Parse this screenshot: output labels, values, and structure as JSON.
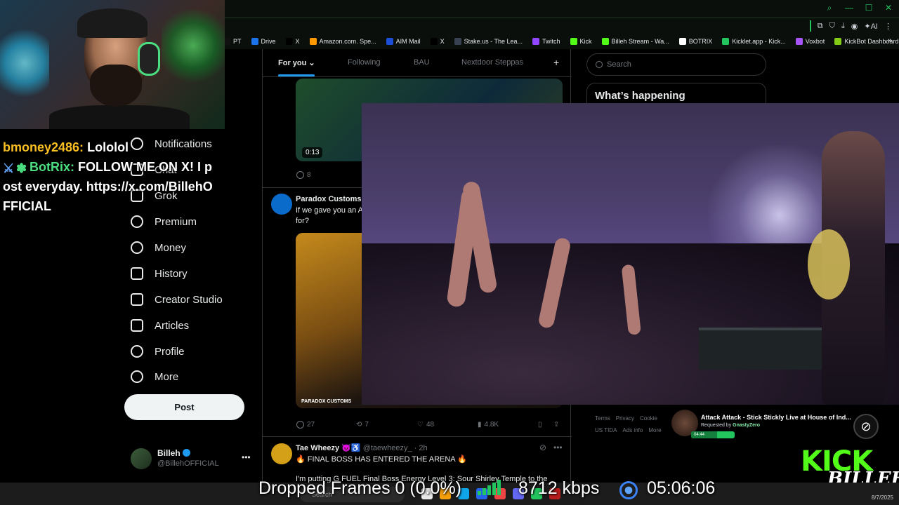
{
  "browser": {
    "bookmarks": [
      {
        "label": "PT",
        "color": "#111111"
      },
      {
        "label": "Drive",
        "color": "#1a73e8"
      },
      {
        "label": "X",
        "color": "#000000"
      },
      {
        "label": "Amazon.com. Spe...",
        "color": "#ff9900"
      },
      {
        "label": "AIM Mail",
        "color": "#1d4ed8"
      },
      {
        "label": "X",
        "color": "#000000"
      },
      {
        "label": "Stake.us - The Lea...",
        "color": "#374151"
      },
      {
        "label": "Twitch",
        "color": "#9146ff"
      },
      {
        "label": "Kick",
        "color": "#53fc18"
      },
      {
        "label": "Billeh Stream - Wa...",
        "color": "#53fc18"
      },
      {
        "label": "BOTRIX",
        "color": "#ffffff"
      },
      {
        "label": "Kicklet.app - Kick...",
        "color": "#22c55e"
      },
      {
        "label": "Voxbot",
        "color": "#a855f7"
      },
      {
        "label": "KickBot Dashboard",
        "color": "#84cc16"
      }
    ]
  },
  "nav": {
    "notifications": "Notifications",
    "chat": "Chat",
    "grok": "Grok",
    "premium": "Premium",
    "money": "Money",
    "history": "History",
    "creator_studio": "Creator Studio",
    "articles": "Articles",
    "profile": "Profile",
    "more": "More",
    "post_button": "Post"
  },
  "account": {
    "name": "Billeh",
    "handle": "@BillehOFFICIAL"
  },
  "feed": {
    "tabs": [
      "For you",
      "Following",
      "BAU",
      "Nextdoor Steppas"
    ],
    "post1": {
      "duration": "0:13",
      "replies": "8"
    },
    "post2": {
      "author": "Paradox Customs",
      "text_line1": "If we gave you an A",
      "text_line2": "for?",
      "media_caption": "PARADOX CUSTOMS",
      "replies": "27",
      "reposts": "7",
      "likes": "48",
      "views": "4.8K"
    },
    "post3": {
      "author": "Tae Wheezy",
      "handle": "@taewheezy_",
      "time": "· 2h",
      "text_line1": "🔥 FINAL BOSS HAS ENTERED THE ARENA 🔥",
      "text_line2": "I'm putting G FUEL Final Boss Energy Level 3: Sour Shirley Temple to the"
    }
  },
  "right": {
    "search_placeholder": "Search",
    "trends_title": "What’s happening",
    "footer": [
      "Terms",
      "Privacy",
      "Cookie",
      "US TIDA",
      "Ads info",
      "More"
    ]
  },
  "stream": {
    "chat": [
      {
        "user": "bmoney2486:",
        "message": "Lololol"
      },
      {
        "user": "BotRix:",
        "message": "FOLLOW ME ON X! I post everyday. https://x.com/BillehOFFICIAL"
      }
    ],
    "now_playing": {
      "title": "Attack Attack - Stick Stickly Live at House of Ind...",
      "requested_prefix": "Requested by",
      "requested_by": "GnastyZero",
      "time": "04:44",
      "progress": 0.6
    },
    "kick_logo_text": "KICK",
    "streamer_signature": "BILLEH",
    "stats": {
      "dropped_frames": "Dropped Frames 0 (0.0%)",
      "bitrate": "8712 kbps",
      "uptime": "05:06:06"
    }
  },
  "taskbar": {
    "search_placeholder": "Search",
    "date": "8/7/2025"
  }
}
